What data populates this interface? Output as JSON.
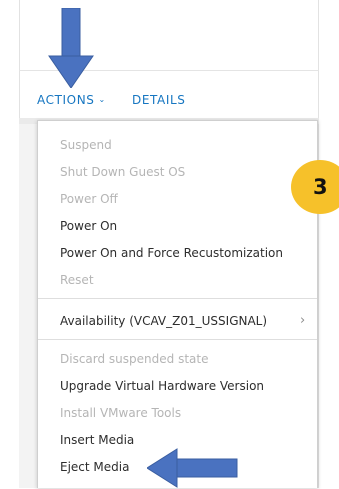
{
  "toolbar": {
    "actions_label": "ACTIONS",
    "details_label": "DETAILS"
  },
  "menu": {
    "items": [
      {
        "label": "Suspend",
        "disabled": true
      },
      {
        "label": "Shut Down Guest OS",
        "disabled": true
      },
      {
        "label": "Power Off",
        "disabled": true
      },
      {
        "label": "Power On",
        "disabled": false
      },
      {
        "label": "Power On and Force Recustomization",
        "disabled": false
      },
      {
        "label": "Reset",
        "disabled": true
      },
      {
        "label": "Availability (VCAV_Z01_USSIGNAL)",
        "disabled": false,
        "submenu": true
      },
      {
        "label": "Discard suspended state",
        "disabled": true
      },
      {
        "label": "Upgrade Virtual Hardware Version",
        "disabled": false
      },
      {
        "label": "Install VMware Tools",
        "disabled": true
      },
      {
        "label": "Insert Media",
        "disabled": false
      },
      {
        "label": "Eject Media",
        "disabled": false
      }
    ]
  },
  "annotation": {
    "step_number": "3",
    "badge_color": "#f6c12a",
    "arrow_color": "#4a72c0"
  },
  "colors": {
    "accent": "#1676c1",
    "disabled_text": "#b5b5b5",
    "enabled_text": "#2d2d2d"
  }
}
